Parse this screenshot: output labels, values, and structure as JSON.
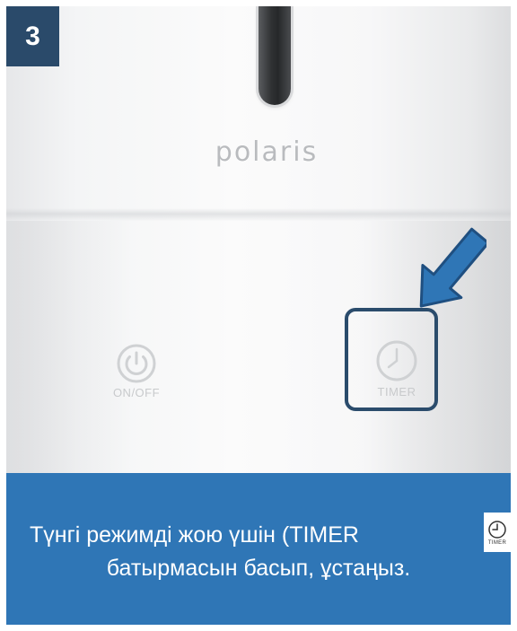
{
  "step_number": "3",
  "brand": "polaris",
  "controls": {
    "onoff_label": "ON/OFF",
    "timer_label": "TIMER"
  },
  "caption": {
    "line1": "Түнгі режимді жою үшін (TIMER",
    "line2": "батырмасын басып, ұстаңыз.",
    "icon_label": "TIMER",
    "background_color": "#2f76b6"
  },
  "accent_colors": {
    "arrow": "#2f76b6",
    "highlight_border": "#2b4c6c",
    "badge": "#2a4a6a"
  },
  "icons": [
    "power-icon",
    "clock-icon",
    "arrow-icon"
  ]
}
